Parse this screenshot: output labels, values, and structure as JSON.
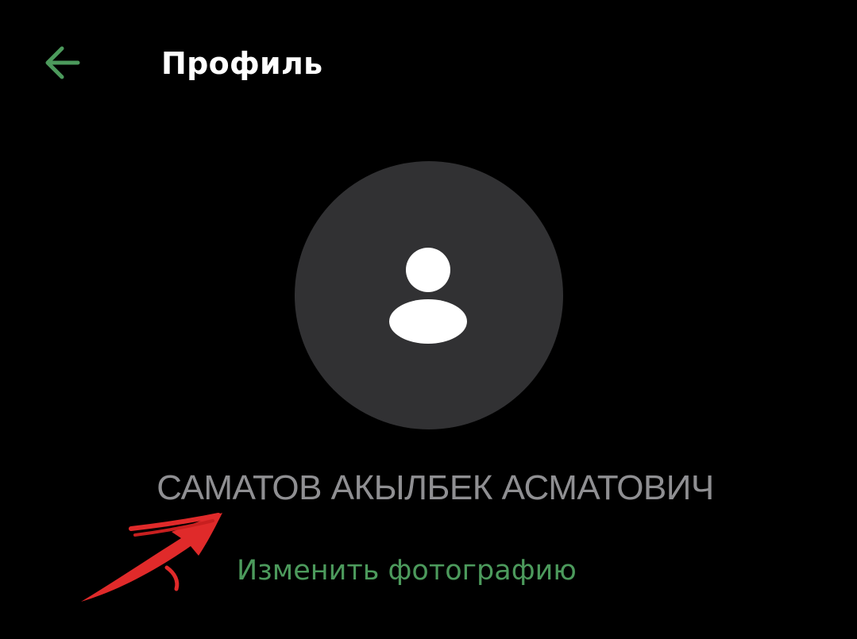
{
  "header": {
    "title": "Профиль",
    "back_icon": "arrow-left-icon"
  },
  "profile": {
    "avatar_icon": "person-icon",
    "full_name": "САМАТОВ АКЫЛБЕК АСМАТОВИЧ",
    "change_photo_label": "Изменить фотографию"
  },
  "annotation": {
    "icon": "red-arrow-annotation"
  },
  "colors": {
    "background": "#000000",
    "title": "#ffffff",
    "accent_green": "#4c9a5c",
    "avatar_bg": "#313133",
    "name_gray": "#8f8f92",
    "annotation_red": "#e02a2a"
  }
}
